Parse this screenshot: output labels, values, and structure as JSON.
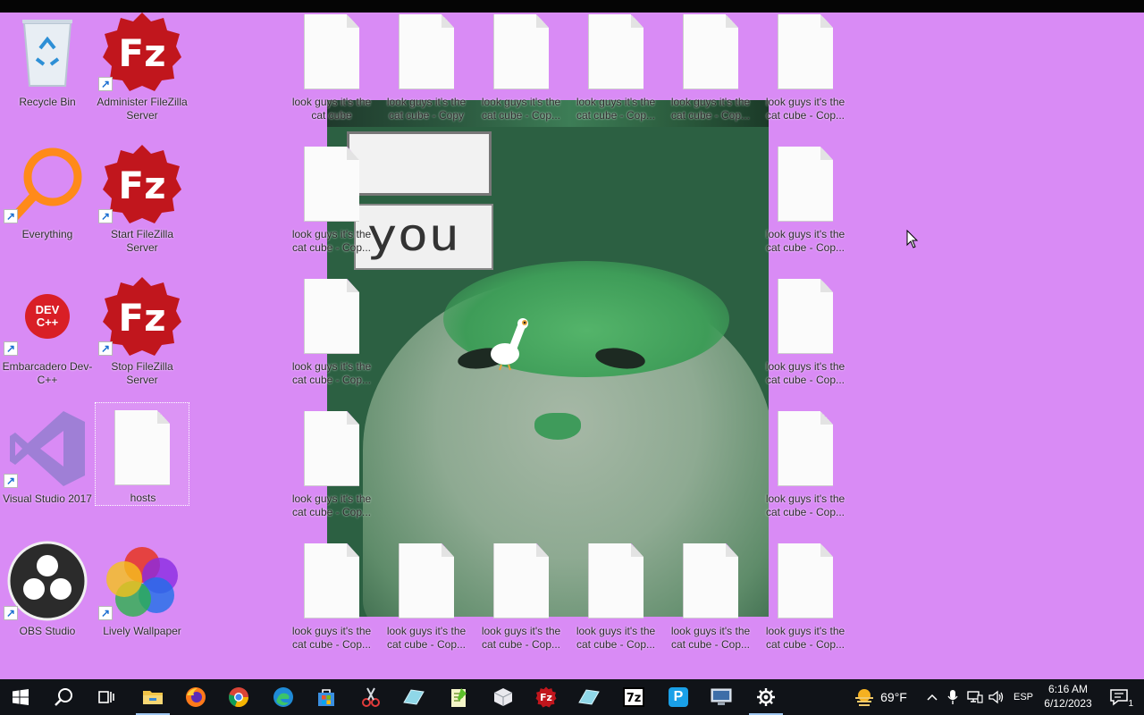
{
  "colors": {
    "desktop_bg": "#d98bf5",
    "taskbar_bg": "#101318",
    "filezilla_red": "#c1161d",
    "vs_purple": "#9f7fd6"
  },
  "desktop": {
    "left_icons": [
      {
        "label": "Recycle Bin",
        "icon": "recycle-bin-icon"
      },
      {
        "label": "Administer FileZilla Server",
        "icon": "filezilla-icon",
        "shortcut": true
      },
      {
        "label": "Everything",
        "icon": "search-magnifier-icon",
        "shortcut": true
      },
      {
        "label": "Start FileZilla Server",
        "icon": "filezilla-icon",
        "shortcut": true
      },
      {
        "label": "Embarcadero Dev-C++",
        "icon": "devcpp-icon",
        "shortcut": true,
        "icon_text": "DEV C++"
      },
      {
        "label": "Stop FileZilla Server",
        "icon": "filezilla-icon",
        "shortcut": true
      },
      {
        "label": "Visual Studio 2017",
        "icon": "visual-studio-icon",
        "shortcut": true
      },
      {
        "label": "hosts",
        "icon": "document-icon",
        "selected": true
      },
      {
        "label": "OBS Studio",
        "icon": "obs-icon",
        "shortcut": true
      },
      {
        "label": "Lively Wallpaper",
        "icon": "lively-wallpaper-icon",
        "shortcut": true
      }
    ],
    "cat_files": {
      "first": "look guys it's the cat cube",
      "copy": "look guys it's the cat cube - Copy",
      "copy_truncated": "look guys it's the cat cube - Cop..."
    },
    "wallpaper_text": "you"
  },
  "taskbar": {
    "apps": [
      {
        "name": "start-button",
        "icon": "windows-logo-icon"
      },
      {
        "name": "search-button",
        "icon": "search-icon"
      },
      {
        "name": "task-view-button",
        "icon": "task-view-icon"
      },
      {
        "name": "file-explorer",
        "icon": "folder-icon",
        "active": true
      },
      {
        "name": "firefox",
        "icon": "firefox-icon"
      },
      {
        "name": "chrome",
        "icon": "chrome-icon"
      },
      {
        "name": "edge",
        "icon": "edge-icon"
      },
      {
        "name": "microsoft-store",
        "icon": "store-icon"
      },
      {
        "name": "snipping-tool",
        "icon": "scissors-icon"
      },
      {
        "name": "app-blue-1",
        "icon": "eraser-icon"
      },
      {
        "name": "notepad-plus",
        "icon": "notepad-icon"
      },
      {
        "name": "virtualbox",
        "icon": "cube-icon"
      },
      {
        "name": "filezilla",
        "icon": "filezilla-icon"
      },
      {
        "name": "app-blue-2",
        "icon": "eraser-icon"
      },
      {
        "name": "7zip",
        "icon": "7zip-icon",
        "icon_text": "7z"
      },
      {
        "name": "app-p",
        "icon": "p-app-icon",
        "icon_text": "P"
      },
      {
        "name": "remote-desktop",
        "icon": "monitor-icon"
      },
      {
        "name": "settings",
        "icon": "gear-icon",
        "active": true
      }
    ],
    "weather": {
      "temp": "69°F",
      "icon": "sun-haze-icon"
    },
    "tray": {
      "language": "ESP",
      "notifications": "1"
    },
    "clock": {
      "time": "6:16 AM",
      "date": "6/12/2023"
    }
  }
}
